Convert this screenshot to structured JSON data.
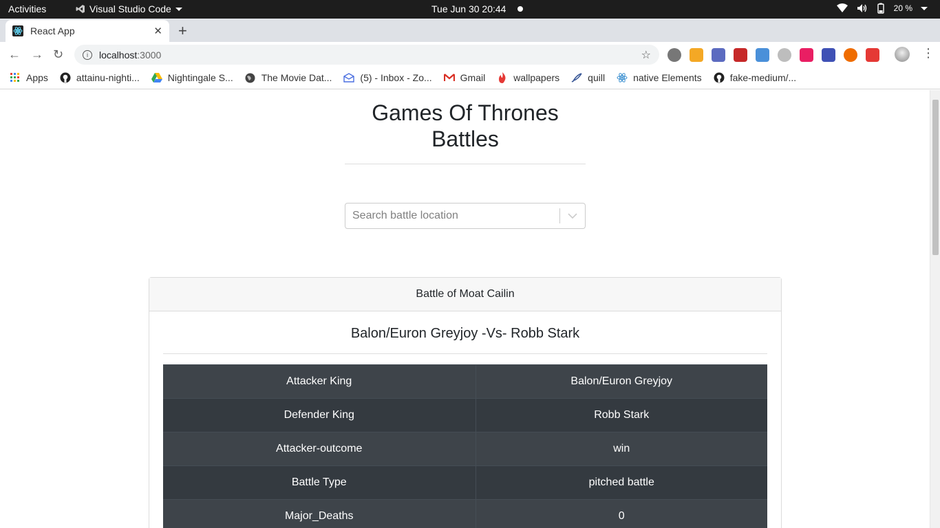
{
  "os": {
    "activities": "Activities",
    "app_name": "Visual Studio Code",
    "clock": "Tue Jun 30  20:44",
    "battery": "20 %"
  },
  "browser": {
    "tab_title": "React App",
    "url_host": "localhost",
    "url_port": ":3000",
    "bookmarks": [
      {
        "label": "Apps",
        "icon": "apps-grid-icon"
      },
      {
        "label": "attainu-nighti...",
        "icon": "github-icon"
      },
      {
        "label": "Nightingale S...",
        "icon": "google-drive-icon"
      },
      {
        "label": "The Movie Dat...",
        "icon": "globe-icon"
      },
      {
        "label": "(5) - Inbox - Zo...",
        "icon": "mail-icon"
      },
      {
        "label": "Gmail",
        "icon": "gmail-icon"
      },
      {
        "label": "wallpapers",
        "icon": "flame-icon"
      },
      {
        "label": "quill",
        "icon": "quill-icon"
      },
      {
        "label": "native Elements",
        "icon": "react-icon"
      },
      {
        "label": "fake-medium/...",
        "icon": "github-icon"
      }
    ],
    "extensions": [
      {
        "icon": "extension-dark-circle-icon",
        "color": "#777777"
      },
      {
        "icon": "extension-orange-icon",
        "color": "#f4a825"
      },
      {
        "icon": "extension-12h-icon",
        "color": "#5c6bc0"
      },
      {
        "icon": "extension-red-puzzle-icon",
        "color": "#c62828"
      },
      {
        "icon": "extension-blue-drop-icon",
        "color": "#4a90d9"
      },
      {
        "icon": "extension-clock-icon",
        "color": "#bdbdbd"
      },
      {
        "icon": "extension-color-grid-icon",
        "color": "#e91e63"
      },
      {
        "icon": "extension-on-badge-icon",
        "color": "#3f51b5"
      },
      {
        "icon": "extension-bottle-icon",
        "color": "#ef6c00"
      },
      {
        "icon": "extension-opera-icon",
        "color": "#e53935"
      }
    ]
  },
  "page": {
    "title": "Games Of Thrones Battles",
    "search_placeholder": "Search battle location",
    "battle": {
      "name": "Battle of Moat Cailin",
      "matchup": "Balon/Euron Greyjoy -Vs- Robb Stark",
      "rows": [
        {
          "key": "Attacker King",
          "value": "Balon/Euron Greyjoy"
        },
        {
          "key": "Defender King",
          "value": "Robb Stark"
        },
        {
          "key": "Attacker-outcome",
          "value": "win"
        },
        {
          "key": "Battle Type",
          "value": "pitched battle"
        },
        {
          "key": "Major_Deaths",
          "value": "0"
        }
      ]
    }
  }
}
